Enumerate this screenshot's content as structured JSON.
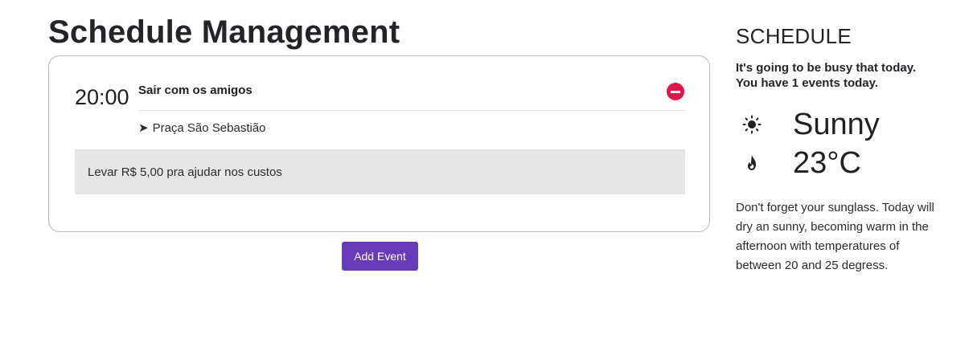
{
  "page": {
    "title": "Schedule Management"
  },
  "event": {
    "time": "20:00",
    "title": "Sair com os amigos",
    "location": "Praça São Sebastião",
    "note": "Levar R$ 5,00 pra ajudar nos custos",
    "remove_icon": "minus-circle-icon",
    "location_icon": "arrow-right-icon"
  },
  "actions": {
    "add_event_label": "Add Event"
  },
  "sidebar": {
    "title": "SCHEDULE",
    "busy_line1": "It's going to be busy that today.",
    "busy_prefix": "You have ",
    "busy_count": "1 events",
    "busy_suffix": " today.",
    "weather": {
      "condition": "Sunny",
      "condition_icon": "sun-icon",
      "temperature": "23°C",
      "temperature_icon": "flame-icon"
    },
    "description": "Don't forget your sunglass. Today will dry an sunny, becoming warm in the afternoon with temperatures of between 20 and 25 degress."
  },
  "colors": {
    "accent": "#6a3bb9",
    "danger": "#e0154a",
    "note_bg": "#e6e6e6"
  }
}
